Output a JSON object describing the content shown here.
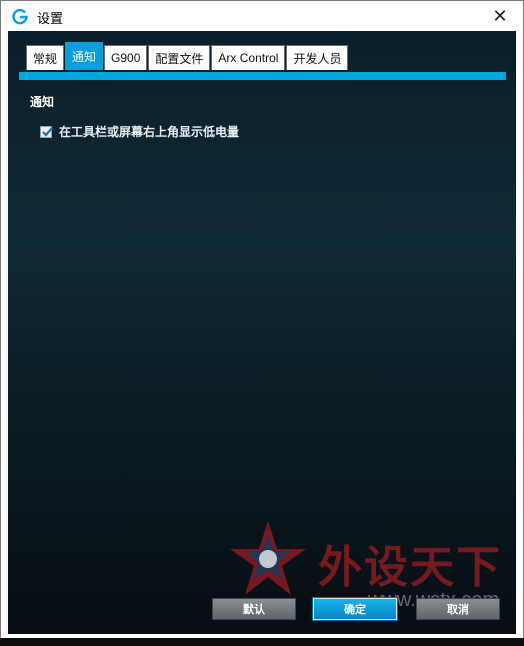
{
  "window": {
    "title": "设置",
    "close_symbol": "✕"
  },
  "tabs": [
    {
      "label": "常规",
      "active": false
    },
    {
      "label": "通知",
      "active": true
    },
    {
      "label": "G900",
      "active": false
    },
    {
      "label": "配置文件",
      "active": false
    },
    {
      "label": "Arx Control",
      "active": false
    },
    {
      "label": "开发人员",
      "active": false
    }
  ],
  "notifications": {
    "section_title": "通知",
    "low_battery": {
      "label": "在工具栏或屏幕右上角显示低电量",
      "checked": true
    }
  },
  "footer": {
    "default_label": "默认",
    "ok_label": "确定",
    "cancel_label": "取消"
  },
  "watermark": {
    "text": "外设天下",
    "url": "www.wstx.com"
  },
  "colors": {
    "accent": "#00a7e1",
    "active_tab": "#0a9fdc",
    "background": "#0c1f2b"
  }
}
